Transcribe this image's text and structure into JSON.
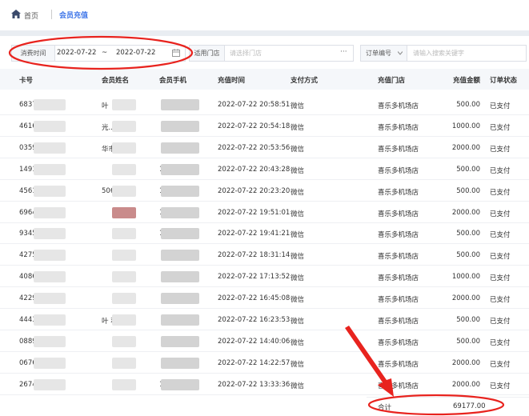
{
  "breadcrumb": {
    "home": "首页",
    "current": "会员充值"
  },
  "filters": {
    "date_label": "消费时间",
    "date_start": "2022-07-22",
    "date_sep": "~",
    "date_end": "2022-07-22",
    "store_label": "适用门店",
    "store_placeholder": "请选择门店",
    "order_select": "订单编号",
    "order_placeholder": "请输入搜索关键字"
  },
  "table": {
    "columns": [
      "卡号",
      "会员姓名",
      "会员手机",
      "充值时间",
      "支付方式",
      "充值门店",
      "充值金额",
      "订单状态"
    ],
    "rows": [
      {
        "card": "68375",
        "name": "叶",
        "phone": "",
        "time": "2022-07-22 20:58:51",
        "pay": "微信",
        "store": "喜乐多机场店",
        "amount": "500.00",
        "status": "已支付"
      },
      {
        "card": "4616",
        "name": "光...",
        "phone": "",
        "time": "2022-07-22 20:54:18",
        "pay": "微信",
        "store": "喜乐多机场店",
        "amount": "1000.00",
        "status": "已支付"
      },
      {
        "card": "0359",
        "name": "华市...",
        "phone": "",
        "time": "2022-07-22 20:53:56",
        "pay": "微信",
        "store": "喜乐多机场店",
        "amount": "2000.00",
        "status": "已支付"
      },
      {
        "card": "1491",
        "name": "",
        "phone": "1",
        "time": "2022-07-22 20:43:28",
        "pay": "微信",
        "store": "喜乐多机场店",
        "amount": "500.00",
        "status": "已支付"
      },
      {
        "card": "4561",
        "name": "5065...",
        "phone": "1",
        "time": "2022-07-22 20:23:20",
        "pay": "微信",
        "store": "喜乐多机场店",
        "amount": "500.00",
        "status": "已支付"
      },
      {
        "card": "6964",
        "name": "",
        "phone": "1",
        "time": "2022-07-22 19:51:01",
        "pay": "微信",
        "store": "喜乐多机场店",
        "amount": "2000.00",
        "status": "已支付"
      },
      {
        "card": "9345",
        "name": "",
        "phone": "1",
        "time": "2022-07-22 19:41:21",
        "pay": "微信",
        "store": "喜乐多机场店",
        "amount": "500.00",
        "status": "已支付"
      },
      {
        "card": "4275",
        "name": "",
        "phone": "",
        "time": "2022-07-22 18:31:14",
        "pay": "微信",
        "store": "喜乐多机场店",
        "amount": "500.00",
        "status": "已支付"
      },
      {
        "card": "4086",
        "name": "",
        "phone": "",
        "time": "2022-07-22 17:13:52",
        "pay": "微信",
        "store": "喜乐多机场店",
        "amount": "1000.00",
        "status": "已支付"
      },
      {
        "card": "4229",
        "name": "",
        "phone": "",
        "time": "2022-07-22 16:45:08",
        "pay": "微信",
        "store": "喜乐多机场店",
        "amount": "2000.00",
        "status": "已支付"
      },
      {
        "card": "4443",
        "name": "叶 菲",
        "phone": "",
        "time": "2022-07-22 16:23:53",
        "pay": "微信",
        "store": "喜乐多机场店",
        "amount": "500.00",
        "status": "已支付"
      },
      {
        "card": "0889",
        "name": "",
        "phone": "",
        "time": "2022-07-22 14:40:06",
        "pay": "微信",
        "store": "喜乐多机场店",
        "amount": "500.00",
        "status": "已支付"
      },
      {
        "card": "0676",
        "name": "",
        "phone": "",
        "time": "2022-07-22 14:22:57",
        "pay": "微信",
        "store": "喜乐多机场店",
        "amount": "2000.00",
        "status": "已支付"
      },
      {
        "card": "2674",
        "name": "",
        "phone": "1202",
        "time": "2022-07-22 13:33:36",
        "pay": "微信",
        "store": "喜乐多机场店",
        "amount": "2000.00",
        "status": "已支付"
      }
    ]
  },
  "footer": {
    "total_label": "合计",
    "total_value": "69177.00"
  },
  "colors": {
    "accent": "#3b73e8",
    "annotation": "#e8231e"
  }
}
